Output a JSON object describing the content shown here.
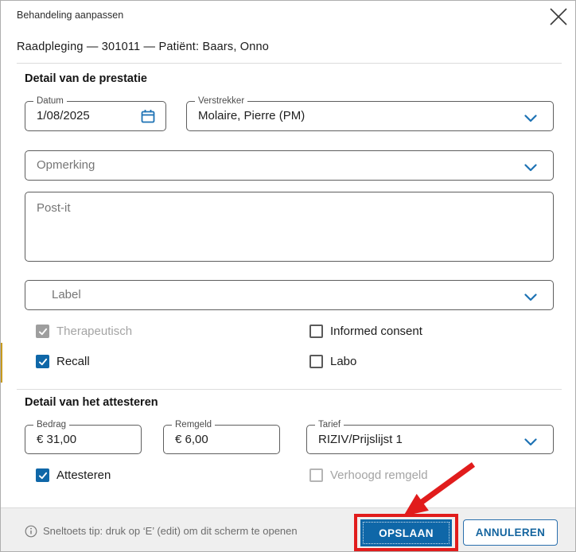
{
  "dialog": {
    "title": "Behandeling aanpassen",
    "subtitle": "Raadpleging — 301011 — Patiënt: Baars, Onno",
    "close_icon": "close-x-icon"
  },
  "prestatie": {
    "heading": "Detail van de prestatie",
    "datum": {
      "label": "Datum",
      "value": "1/08/2025",
      "icon": "calendar-icon"
    },
    "verstrekker": {
      "label": "Verstrekker",
      "value": "Molaire, Pierre (PM)",
      "icon": "chevron-down-icon"
    },
    "opmerking": {
      "placeholder": "Opmerking",
      "icon": "chevron-down-icon"
    },
    "postit": {
      "placeholder": "Post-it"
    },
    "label_select": {
      "placeholder": "Label",
      "icon": "chevron-down-icon"
    },
    "checkboxes": [
      {
        "label": "Therapeutisch",
        "checked": true,
        "disabled": true
      },
      {
        "label": "Informed consent",
        "checked": false,
        "disabled": false
      },
      {
        "label": "Recall",
        "checked": true,
        "disabled": false
      },
      {
        "label": "Labo",
        "checked": false,
        "disabled": false
      }
    ]
  },
  "attesteren": {
    "heading": "Detail van het attesteren",
    "bedrag": {
      "label": "Bedrag",
      "value": "€ 31,00"
    },
    "remgeld": {
      "label": "Remgeld",
      "value": "€ 6,00"
    },
    "tarief": {
      "label": "Tarief",
      "value": "RIZIV/Prijslijst 1",
      "icon": "chevron-down-icon"
    },
    "checkboxes": [
      {
        "label": "Attesteren",
        "checked": true,
        "disabled": false
      },
      {
        "label": "Verhoogd remgeld",
        "checked": false,
        "disabled": true
      }
    ]
  },
  "footer": {
    "tip_icon": "info-icon",
    "tip": "Sneltoets tip: druk op ‘E’ (edit) om dit scherm te openen",
    "save_label": "OPSLAAN",
    "cancel_label": "ANNULEREN"
  },
  "annotations": {
    "highlight_color": "#e11c1c",
    "arrow_target": "OPSLAAN"
  },
  "colors": {
    "accent_blue": "#0f67a8",
    "icon_blue": "#1d72b4",
    "disabled_gray": "#9e9e9e",
    "footer_bg": "#efefef"
  }
}
